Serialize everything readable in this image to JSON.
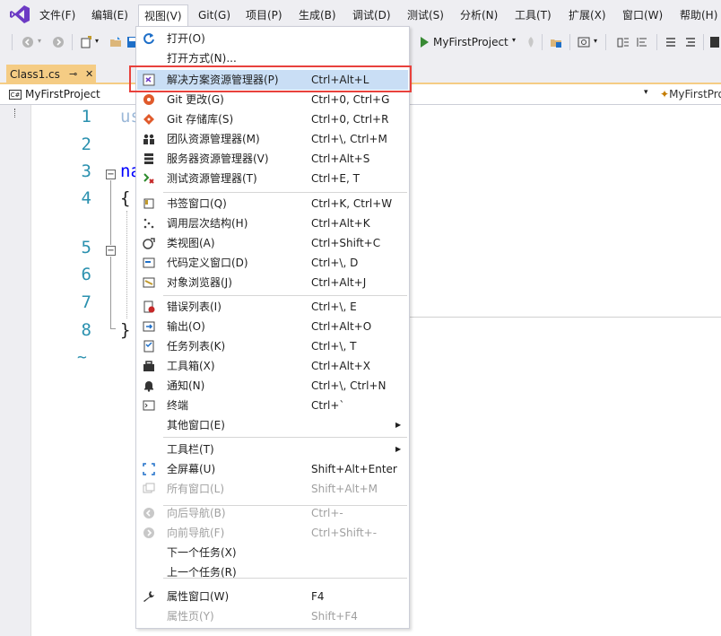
{
  "menubar": {
    "items": [
      "文件(F)",
      "编辑(E)",
      "视图(V)",
      "Git(G)",
      "项目(P)",
      "生成(B)",
      "调试(D)",
      "测试(S)",
      "分析(N)",
      "工具(T)",
      "扩展(X)",
      "窗口(W)",
      "帮助(H)"
    ],
    "active_index": 2
  },
  "toolbar": {
    "run_target": "MyFirstProject"
  },
  "tab": {
    "title": "Class1.cs",
    "pin": "⊸",
    "close": "✕"
  },
  "navbar": {
    "project": "MyFirstProject",
    "right_project": "MyFirstProject"
  },
  "editor": {
    "line_numbers": [
      "1",
      "2",
      "3",
      "4",
      "5",
      "6",
      "7",
      "8"
    ],
    "lines": [
      "us",
      "",
      "na",
      "{",
      "",
      "",
      "",
      "}"
    ],
    "end_marker": "~"
  },
  "view_menu": {
    "items": [
      {
        "label": "打开(O)",
        "shortcut": "",
        "icon": "refresh-arrow-icon"
      },
      {
        "label": "打开方式(N)...",
        "shortcut": "",
        "icon": ""
      },
      {
        "label": "解决方案资源管理器(P)",
        "shortcut": "Ctrl+Alt+L",
        "icon": "solution-explorer-icon",
        "highlighted": true
      },
      {
        "label": "Git 更改(G)",
        "shortcut": "Ctrl+0, Ctrl+G",
        "icon": "git-changes-icon"
      },
      {
        "label": "Git 存储库(S)",
        "shortcut": "Ctrl+0, Ctrl+R",
        "icon": "git-repository-icon"
      },
      {
        "label": "团队资源管理器(M)",
        "shortcut": "Ctrl+\\, Ctrl+M",
        "icon": "team-explorer-icon"
      },
      {
        "label": "服务器资源管理器(V)",
        "shortcut": "Ctrl+Alt+S",
        "icon": "server-explorer-icon"
      },
      {
        "label": "测试资源管理器(T)",
        "shortcut": "Ctrl+E, T",
        "icon": "test-explorer-icon"
      },
      {
        "label": "书签窗口(Q)",
        "shortcut": "Ctrl+K, Ctrl+W",
        "icon": "bookmark-icon"
      },
      {
        "label": "调用层次结构(H)",
        "shortcut": "Ctrl+Alt+K",
        "icon": "call-hierarchy-icon"
      },
      {
        "label": "类视图(A)",
        "shortcut": "Ctrl+Shift+C",
        "icon": "class-view-icon"
      },
      {
        "label": "代码定义窗口(D)",
        "shortcut": "Ctrl+\\, D",
        "icon": "code-definition-icon"
      },
      {
        "label": "对象浏览器(J)",
        "shortcut": "Ctrl+Alt+J",
        "icon": "object-browser-icon"
      },
      {
        "label": "错误列表(I)",
        "shortcut": "Ctrl+\\, E",
        "icon": "error-list-icon"
      },
      {
        "label": "输出(O)",
        "shortcut": "Ctrl+Alt+O",
        "icon": "output-icon"
      },
      {
        "label": "任务列表(K)",
        "shortcut": "Ctrl+\\, T",
        "icon": "task-list-icon"
      },
      {
        "label": "工具箱(X)",
        "shortcut": "Ctrl+Alt+X",
        "icon": "toolbox-icon"
      },
      {
        "label": "通知(N)",
        "shortcut": "Ctrl+\\, Ctrl+N",
        "icon": "bell-icon"
      },
      {
        "label": "终端",
        "shortcut": "Ctrl+`",
        "icon": "terminal-icon"
      },
      {
        "label": "其他窗口(E)",
        "shortcut": "",
        "icon": "",
        "submenu": true
      },
      {
        "label": "工具栏(T)",
        "shortcut": "",
        "icon": "",
        "submenu": true
      },
      {
        "label": "全屏幕(U)",
        "shortcut": "Shift+Alt+Enter",
        "icon": "fullscreen-icon"
      },
      {
        "label": "所有窗口(L)",
        "shortcut": "Shift+Alt+M",
        "icon": "all-windows-icon",
        "disabled": true
      },
      {
        "label": "向后导航(B)",
        "shortcut": "Ctrl+-",
        "icon": "navigate-back-icon",
        "disabled": true
      },
      {
        "label": "向前导航(F)",
        "shortcut": "Ctrl+Shift+-",
        "icon": "navigate-forward-icon",
        "disabled": true
      },
      {
        "label": "下一个任务(X)",
        "shortcut": "",
        "icon": ""
      },
      {
        "label": "上一个任务(R)",
        "shortcut": "",
        "icon": ""
      },
      {
        "label": "属性窗口(W)",
        "shortcut": "F4",
        "icon": "wrench-icon"
      },
      {
        "label": "属性页(Y)",
        "shortcut": "Shift+F4",
        "icon": "",
        "disabled": true
      }
    ]
  },
  "colors": {
    "accent_highlight": "#c9def5",
    "callout_red": "#e8413c",
    "tab_gold": "#f5cc84",
    "line_number": "#2b91af",
    "keyword": "#0000ff"
  }
}
